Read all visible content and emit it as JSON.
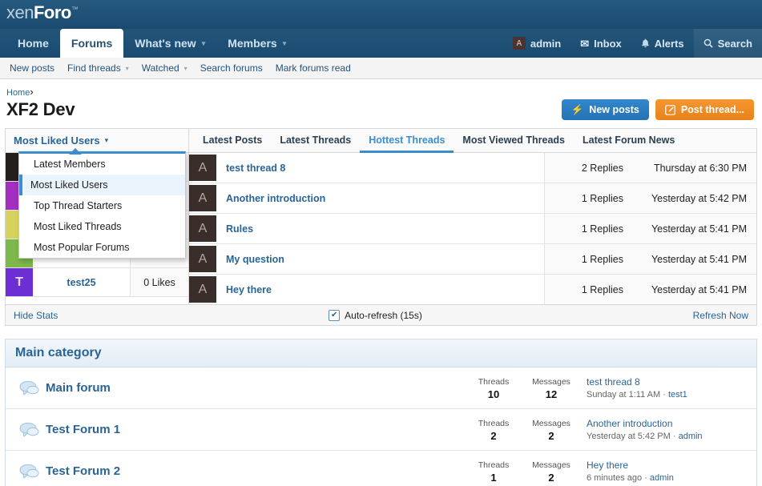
{
  "site": {
    "logo_xen": "xen",
    "logo_foro": "Foro",
    "logo_tm": "™"
  },
  "nav": {
    "tabs": [
      {
        "label": "Home",
        "caret": "",
        "active": false
      },
      {
        "label": "Forums",
        "caret": "",
        "active": true
      },
      {
        "label": "What's new",
        "caret": "▾",
        "active": false
      },
      {
        "label": "Members",
        "caret": "▾",
        "active": false
      }
    ],
    "right": [
      {
        "label": "admin",
        "icon": "user-avatar-icon",
        "glyph": "A"
      },
      {
        "label": "Inbox",
        "icon": "envelope-icon",
        "glyph": "✉"
      },
      {
        "label": "Alerts",
        "icon": "bell-icon",
        "glyph": "🔔"
      },
      {
        "label": "Search",
        "icon": "search-icon",
        "glyph": "🔍"
      }
    ]
  },
  "subnav": [
    {
      "label": "New posts",
      "caret": ""
    },
    {
      "label": "Find threads",
      "caret": "▾"
    },
    {
      "label": "Watched",
      "caret": "▾"
    },
    {
      "label": "Search forums",
      "caret": ""
    },
    {
      "label": "Mark forums read",
      "caret": ""
    }
  ],
  "breadcrumb": {
    "home": "Home",
    "sep": "›"
  },
  "page_title": "XF2 Dev",
  "actions": {
    "new_posts": {
      "label": "New posts",
      "icon": "lightning-bolt-icon",
      "glyph": "⚡",
      "color": "#2b7bc0"
    },
    "post_thread": {
      "label": "Post thread...",
      "icon": "pencil-square-icon",
      "glyph": "✎",
      "color": "#ef8c23"
    }
  },
  "stats": {
    "selector": {
      "label": "Most Liked Users",
      "caret": "▾"
    },
    "dropdown": [
      {
        "label": "Latest Members",
        "selected": false
      },
      {
        "label": "Most Liked Users",
        "selected": true
      },
      {
        "label": "Top Thread Starters",
        "selected": false
      },
      {
        "label": "Most Liked Threads",
        "selected": false
      },
      {
        "label": "Most Popular Forums",
        "selected": false
      }
    ],
    "users": [
      {
        "avatar_letter": "",
        "avatar_color": "#241f1c",
        "name": "",
        "likes": ""
      },
      {
        "avatar_letter": "",
        "avatar_color": "#a32ec0",
        "name": "",
        "likes": ""
      },
      {
        "avatar_letter": "",
        "avatar_color": "#d4d45c",
        "name": "",
        "likes": ""
      },
      {
        "avatar_letter": "",
        "avatar_color": "#7db84a",
        "name": "",
        "likes": ""
      },
      {
        "avatar_letter": "T",
        "avatar_color": "#6b2fd4",
        "name": "test25",
        "likes": "0 Likes"
      }
    ],
    "tabs": [
      {
        "label": "Latest Posts",
        "active": false
      },
      {
        "label": "Latest Threads",
        "active": false
      },
      {
        "label": "Hottest Threads",
        "active": true
      },
      {
        "label": "Most Viewed Threads",
        "active": false
      },
      {
        "label": "Latest Forum News",
        "active": false
      }
    ],
    "threads": [
      {
        "avatar_letter": "A",
        "title": "test thread 8",
        "replies": "2 Replies",
        "date": "Thursday at 6:30 PM"
      },
      {
        "avatar_letter": "A",
        "title": "Another introduction",
        "replies": "1 Replies",
        "date": "Yesterday at 5:42 PM"
      },
      {
        "avatar_letter": "A",
        "title": "Rules",
        "replies": "1 Replies",
        "date": "Yesterday at 5:41 PM"
      },
      {
        "avatar_letter": "A",
        "title": "My question",
        "replies": "1 Replies",
        "date": "Yesterday at 5:41 PM"
      },
      {
        "avatar_letter": "A",
        "title": "Hey there",
        "replies": "1 Replies",
        "date": "Yesterday at 5:41 PM"
      }
    ],
    "footer": {
      "hide_stats": "Hide Stats",
      "auto_refresh": "Auto-refresh (15s)",
      "auto_refresh_checked": true,
      "check_glyph": "✔",
      "refresh_now": "Refresh Now"
    }
  },
  "node_list": {
    "category": "Main category",
    "threads_label": "Threads",
    "messages_label": "Messages",
    "forums": [
      {
        "name": "Main forum",
        "threads": "10",
        "messages": "12",
        "last_title": "test thread 8",
        "last_date": "Sunday at 1:11 AM",
        "last_sep": "·",
        "last_user": "test1"
      },
      {
        "name": "Test Forum 1",
        "threads": "2",
        "messages": "2",
        "last_title": "Another introduction",
        "last_date": "Yesterday at 5:42 PM",
        "last_sep": "·",
        "last_user": "admin"
      },
      {
        "name": "Test Forum 2",
        "threads": "1",
        "messages": "2",
        "last_title": "Hey there",
        "last_date": "6 minutes ago",
        "last_sep": "·",
        "last_user": "admin"
      }
    ]
  },
  "colors": {
    "nav_bg": "#1c4e75",
    "accent_blue": "#3c8dcd",
    "link": "#2a6496",
    "orange": "#ef8c23"
  }
}
